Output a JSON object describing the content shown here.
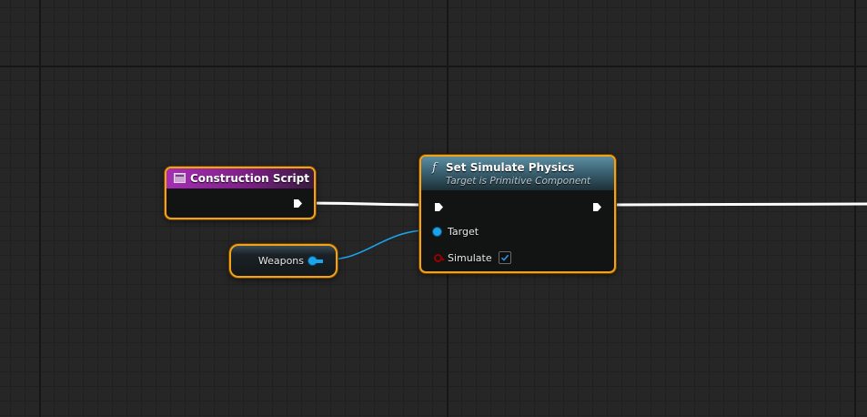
{
  "graph": {
    "background": "#262626",
    "node_border_color": "#f2a11a",
    "exec_wire_color": "#ffffff",
    "object_wire_color": "#1aa4ec"
  },
  "nodes": {
    "construction": {
      "title": "Construction Script",
      "title_icon": "event-icon",
      "title_color": "#a52fb3"
    },
    "weapons": {
      "label": "Weapons",
      "pin_icon": "object-pin-icon"
    },
    "simulate": {
      "title": "Set Simulate Physics",
      "subtitle": "Target is Primitive Component",
      "func_icon": "f",
      "title_color": "#5c8ea2",
      "target_label": "Target",
      "simulate_label": "Simulate",
      "simulate_checked": true
    }
  }
}
